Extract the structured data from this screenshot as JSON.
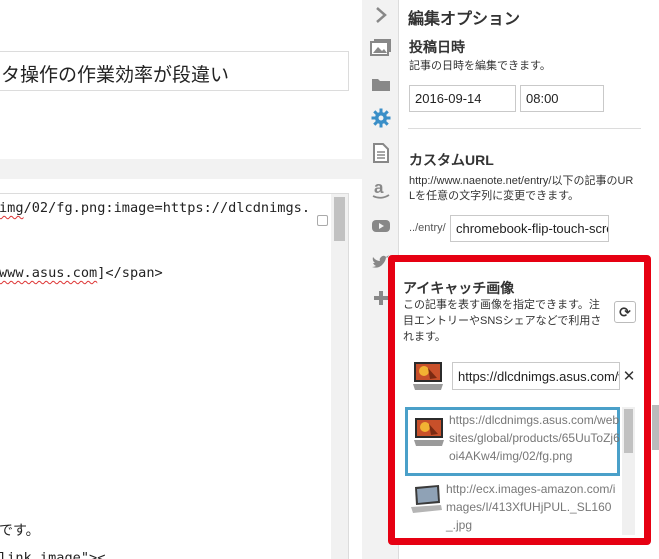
{
  "editor": {
    "title_value": "タ操作の作業効率が段違い",
    "code_lines": [
      {
        "pre": "",
        "u": "img",
        "post": "/02/fg.png:image=https://dlcdnimgs."
      },
      {
        "pre": "",
        "u": "www.asus.com",
        "post": "]</span>"
      }
    ],
    "text_line": "です。",
    "last_line": "link image\">< "
  },
  "rail": {
    "icons": [
      "chevron-right-icon",
      "image-icon",
      "folder-icon",
      "gear-icon",
      "document-icon",
      "amazon-icon",
      "youtube-icon",
      "twitter-icon",
      "plus-icon"
    ]
  },
  "panel": {
    "title": "編集オプション",
    "datetime": {
      "title": "投稿日時",
      "description": "記事の日時を編集できます。",
      "date_value": "2016-09-14",
      "time_value": "08:00"
    },
    "custom_url": {
      "title": "カスタムURL",
      "description_line1": "http://www.naenote.net/entry/以下の記事のUR",
      "description_line2": "Lを任意の文字列に変更できます。",
      "prefix": "../entry/",
      "value": "chromebook-flip-touch-scre"
    },
    "eyecatch": {
      "title": "アイキャッチ画像",
      "description": "この記事を表す画像を指定できます。注目エントリーやSNSシェアなどで利用されます。",
      "reload_glyph": "⟳",
      "clear_glyph": "✕",
      "url_value": "https://dlcdnimgs.asus.com/w",
      "candidates": [
        {
          "url": "https://dlcdnimgs.asus.com/websites/global/products/65UuToZj6oi4AKw4/img/02/fg.png",
          "selected": true
        },
        {
          "url": "http://ecx.images-amazon.com/images/I/413XfUHjPUL._SL160_.jpg",
          "selected": false
        }
      ]
    }
  },
  "colors": {
    "highlight_border": "#e60012",
    "selected_border": "#4aa0c9",
    "active_icon": "#3a8fc8"
  }
}
